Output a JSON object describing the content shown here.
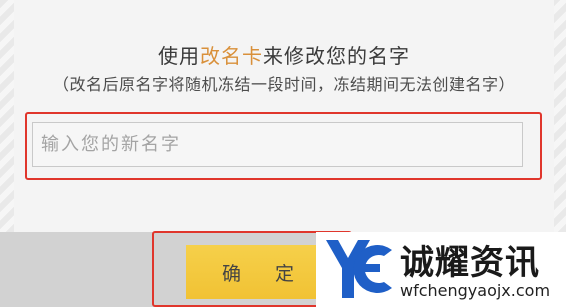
{
  "dialog": {
    "title_prefix": "使用",
    "title_accent": "改名卡",
    "title_suffix": "来修改您的名字",
    "subtitle": "（改名后原名字将随机冻结一段时间，冻结期间无法创建名字）",
    "name_input": {
      "value": "",
      "placeholder": "输入您的新名字"
    },
    "confirm_label": "确 定"
  },
  "watermark": {
    "logo_icon": "yc-logo-icon",
    "title": "诚耀资讯",
    "url": "wfchengyaojx.com"
  },
  "colors": {
    "accent": "#d9903a",
    "highlight": "#e0362c",
    "button": "#f1c234",
    "logo": "#1f5fc7"
  }
}
